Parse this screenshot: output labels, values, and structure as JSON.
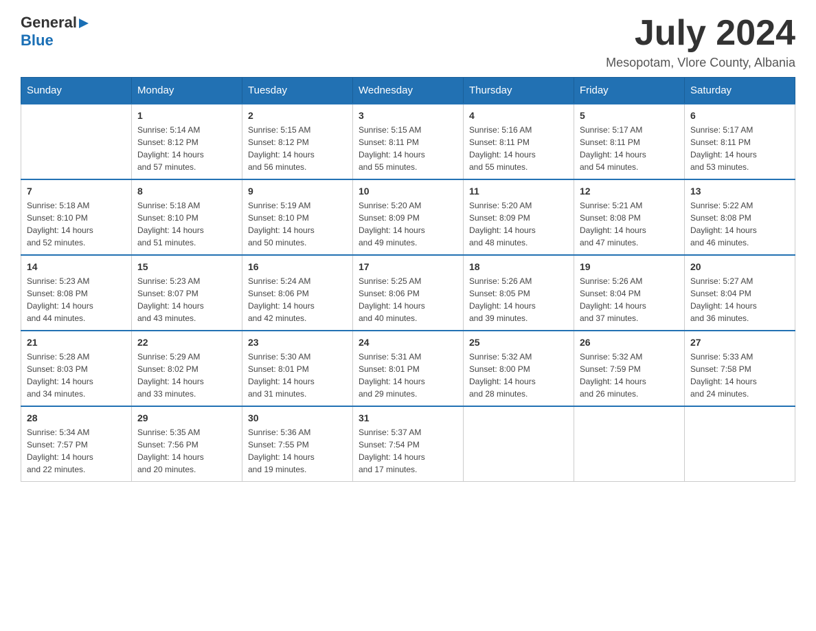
{
  "header": {
    "logo": {
      "general": "General",
      "arrow": "▶",
      "blue": "Blue"
    },
    "title": "July 2024",
    "location": "Mesopotam, Vlore County, Albania"
  },
  "days_of_week": [
    "Sunday",
    "Monday",
    "Tuesday",
    "Wednesday",
    "Thursday",
    "Friday",
    "Saturday"
  ],
  "weeks": [
    [
      {
        "day": "",
        "info": ""
      },
      {
        "day": "1",
        "info": "Sunrise: 5:14 AM\nSunset: 8:12 PM\nDaylight: 14 hours\nand 57 minutes."
      },
      {
        "day": "2",
        "info": "Sunrise: 5:15 AM\nSunset: 8:12 PM\nDaylight: 14 hours\nand 56 minutes."
      },
      {
        "day": "3",
        "info": "Sunrise: 5:15 AM\nSunset: 8:11 PM\nDaylight: 14 hours\nand 55 minutes."
      },
      {
        "day": "4",
        "info": "Sunrise: 5:16 AM\nSunset: 8:11 PM\nDaylight: 14 hours\nand 55 minutes."
      },
      {
        "day": "5",
        "info": "Sunrise: 5:17 AM\nSunset: 8:11 PM\nDaylight: 14 hours\nand 54 minutes."
      },
      {
        "day": "6",
        "info": "Sunrise: 5:17 AM\nSunset: 8:11 PM\nDaylight: 14 hours\nand 53 minutes."
      }
    ],
    [
      {
        "day": "7",
        "info": "Sunrise: 5:18 AM\nSunset: 8:10 PM\nDaylight: 14 hours\nand 52 minutes."
      },
      {
        "day": "8",
        "info": "Sunrise: 5:18 AM\nSunset: 8:10 PM\nDaylight: 14 hours\nand 51 minutes."
      },
      {
        "day": "9",
        "info": "Sunrise: 5:19 AM\nSunset: 8:10 PM\nDaylight: 14 hours\nand 50 minutes."
      },
      {
        "day": "10",
        "info": "Sunrise: 5:20 AM\nSunset: 8:09 PM\nDaylight: 14 hours\nand 49 minutes."
      },
      {
        "day": "11",
        "info": "Sunrise: 5:20 AM\nSunset: 8:09 PM\nDaylight: 14 hours\nand 48 minutes."
      },
      {
        "day": "12",
        "info": "Sunrise: 5:21 AM\nSunset: 8:08 PM\nDaylight: 14 hours\nand 47 minutes."
      },
      {
        "day": "13",
        "info": "Sunrise: 5:22 AM\nSunset: 8:08 PM\nDaylight: 14 hours\nand 46 minutes."
      }
    ],
    [
      {
        "day": "14",
        "info": "Sunrise: 5:23 AM\nSunset: 8:08 PM\nDaylight: 14 hours\nand 44 minutes."
      },
      {
        "day": "15",
        "info": "Sunrise: 5:23 AM\nSunset: 8:07 PM\nDaylight: 14 hours\nand 43 minutes."
      },
      {
        "day": "16",
        "info": "Sunrise: 5:24 AM\nSunset: 8:06 PM\nDaylight: 14 hours\nand 42 minutes."
      },
      {
        "day": "17",
        "info": "Sunrise: 5:25 AM\nSunset: 8:06 PM\nDaylight: 14 hours\nand 40 minutes."
      },
      {
        "day": "18",
        "info": "Sunrise: 5:26 AM\nSunset: 8:05 PM\nDaylight: 14 hours\nand 39 minutes."
      },
      {
        "day": "19",
        "info": "Sunrise: 5:26 AM\nSunset: 8:04 PM\nDaylight: 14 hours\nand 37 minutes."
      },
      {
        "day": "20",
        "info": "Sunrise: 5:27 AM\nSunset: 8:04 PM\nDaylight: 14 hours\nand 36 minutes."
      }
    ],
    [
      {
        "day": "21",
        "info": "Sunrise: 5:28 AM\nSunset: 8:03 PM\nDaylight: 14 hours\nand 34 minutes."
      },
      {
        "day": "22",
        "info": "Sunrise: 5:29 AM\nSunset: 8:02 PM\nDaylight: 14 hours\nand 33 minutes."
      },
      {
        "day": "23",
        "info": "Sunrise: 5:30 AM\nSunset: 8:01 PM\nDaylight: 14 hours\nand 31 minutes."
      },
      {
        "day": "24",
        "info": "Sunrise: 5:31 AM\nSunset: 8:01 PM\nDaylight: 14 hours\nand 29 minutes."
      },
      {
        "day": "25",
        "info": "Sunrise: 5:32 AM\nSunset: 8:00 PM\nDaylight: 14 hours\nand 28 minutes."
      },
      {
        "day": "26",
        "info": "Sunrise: 5:32 AM\nSunset: 7:59 PM\nDaylight: 14 hours\nand 26 minutes."
      },
      {
        "day": "27",
        "info": "Sunrise: 5:33 AM\nSunset: 7:58 PM\nDaylight: 14 hours\nand 24 minutes."
      }
    ],
    [
      {
        "day": "28",
        "info": "Sunrise: 5:34 AM\nSunset: 7:57 PM\nDaylight: 14 hours\nand 22 minutes."
      },
      {
        "day": "29",
        "info": "Sunrise: 5:35 AM\nSunset: 7:56 PM\nDaylight: 14 hours\nand 20 minutes."
      },
      {
        "day": "30",
        "info": "Sunrise: 5:36 AM\nSunset: 7:55 PM\nDaylight: 14 hours\nand 19 minutes."
      },
      {
        "day": "31",
        "info": "Sunrise: 5:37 AM\nSunset: 7:54 PM\nDaylight: 14 hours\nand 17 minutes."
      },
      {
        "day": "",
        "info": ""
      },
      {
        "day": "",
        "info": ""
      },
      {
        "day": "",
        "info": ""
      }
    ]
  ]
}
